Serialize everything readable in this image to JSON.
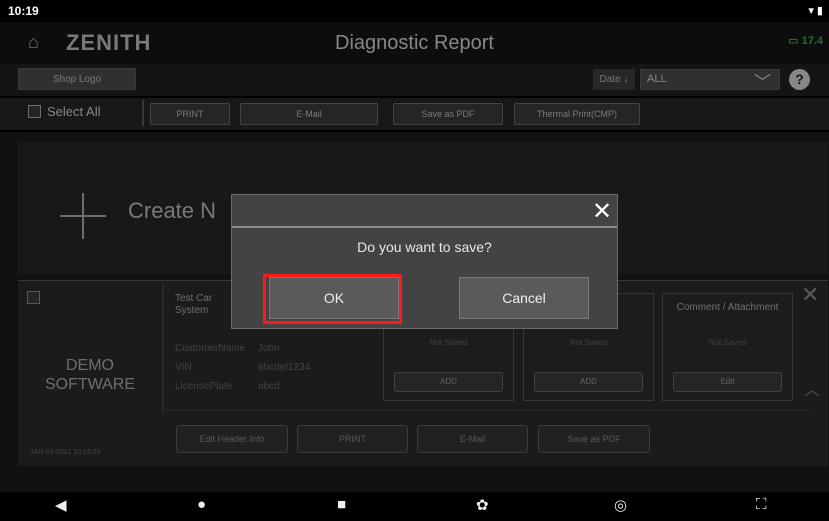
{
  "status_bar": {
    "time": "10:19",
    "system": "▾ ▮"
  },
  "header": {
    "home_icon": "⌂",
    "logo": "ZENITH",
    "title": "Diagnostic Report",
    "battery": "▭ 17.4",
    "battery_color": "#2fae3f"
  },
  "toolbar1": {
    "shop_logo": "Shop Logo",
    "date_label": "Date ↓",
    "filter_value": "ALL",
    "filter_chevron": "╲╱",
    "help": "?"
  },
  "toolbar2": {
    "select_all": "Select All",
    "buttons": [
      "PRINT",
      "E-Mail",
      "Save as PDF",
      "Thermal Print(CMP)"
    ]
  },
  "create": {
    "label": "Create N"
  },
  "report_card": {
    "software": "DEMO\nSOFTWARE",
    "date": "JAN-03-2021 10:13:29",
    "vehicle_title": "Test Car System",
    "fields": [
      {
        "label": "CustomerName",
        "value": "John"
      },
      {
        "label": "VIN",
        "value": "abcdef1234"
      },
      {
        "label": "LicensePlate",
        "value": "abcd"
      }
    ],
    "sections": [
      {
        "heading": "",
        "status": "Not Saved",
        "button": "ADD"
      },
      {
        "heading": "",
        "status": "Not Saved",
        "button": "ADD"
      },
      {
        "heading": "Comment / Attachment",
        "status": "Not Saved",
        "button": "Edit"
      }
    ],
    "bottom_buttons": [
      "Edit Header Info",
      "PRINT",
      "E-Mail",
      "Save as PDF"
    ],
    "close": "✕",
    "collapse": "︿"
  },
  "dialog": {
    "message": "Do you want to save?",
    "close": "✕",
    "ok": "OK",
    "cancel": "Cancel",
    "highlight_color": "#ff1a1a"
  },
  "navbar": {
    "back": "◀",
    "home": "●",
    "recents": "■",
    "settings": "✿",
    "app": "◎",
    "screenshot": "⛶"
  }
}
